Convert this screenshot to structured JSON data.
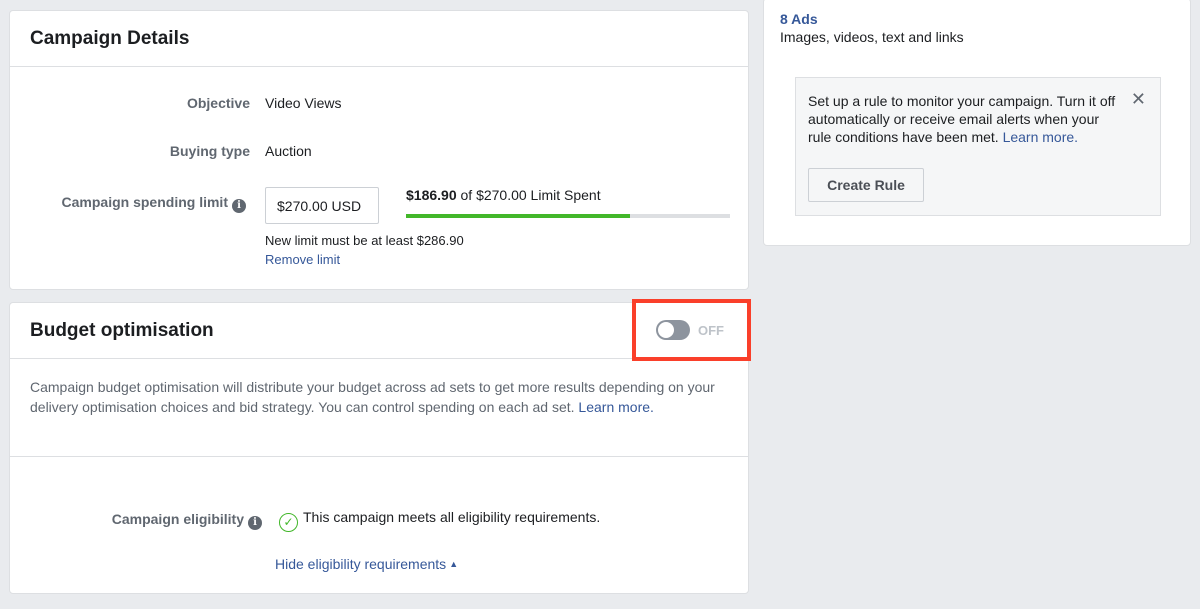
{
  "campaign_details": {
    "title": "Campaign Details",
    "objective_label": "Objective",
    "objective_value": "Video Views",
    "buying_type_label": "Buying type",
    "buying_type_value": "Auction",
    "spending_limit_label": "Campaign spending limit",
    "spending_limit_input": "$270.00 USD",
    "spent_amount": "$186.90",
    "spent_suffix": "of $270.00 Limit Spent",
    "spent_fraction": 0.6922,
    "min_limit_note": "New limit must be at least $286.90",
    "remove_limit_link": "Remove limit"
  },
  "budget_optimisation": {
    "title": "Budget optimisation",
    "toggle_state": "OFF",
    "description": "Campaign budget optimisation will distribute your budget across ad sets to get more results depending on your delivery optimisation choices and bid strategy. You can control spending on each ad set.",
    "learn_more": "Learn more.",
    "eligibility_label": "Campaign eligibility",
    "eligibility_text": "This campaign meets all eligibility requirements.",
    "hide_requirements_link": "Hide eligibility requirements"
  },
  "right_panel": {
    "ads_count": "8 Ads",
    "ads_desc": "Images, videos, text and links",
    "rule_text": "Set up a rule to monitor your campaign. Turn it off automatically or receive email alerts when your rule conditions have been met.",
    "rule_learn_more": "Learn more.",
    "create_rule_button": "Create Rule"
  },
  "colors": {
    "link": "#365899",
    "progress": "#42b72a",
    "highlight": "#fa3f2a",
    "background": "#e9ebee"
  },
  "icons": {
    "info": "info-icon",
    "check": "check-circle-icon",
    "close": "close-icon",
    "caret": "caret-up-icon"
  }
}
